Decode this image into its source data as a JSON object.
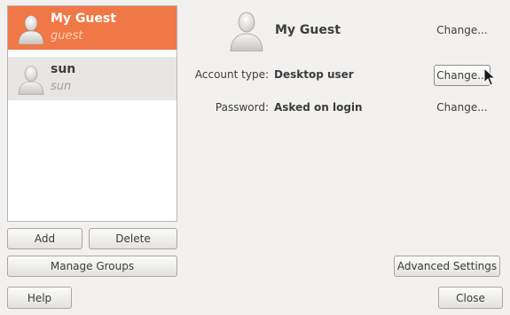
{
  "users": [
    {
      "name": "My Guest",
      "login": "guest",
      "selected": true
    },
    {
      "name": "sun",
      "login": "sun",
      "selected": false
    }
  ],
  "list_buttons": {
    "add": "Add",
    "delete": "Delete",
    "manage_groups": "Manage Groups"
  },
  "details": {
    "name": "My Guest",
    "name_change": "Change...",
    "account_type_label": "Account type:",
    "account_type_value": "Desktop user",
    "account_type_change": "Change...",
    "password_label": "Password:",
    "password_value": "Asked on login",
    "password_change": "Change..."
  },
  "footer": {
    "advanced_settings": "Advanced Settings",
    "help": "Help",
    "close": "Close"
  },
  "colors": {
    "selection": "#f07746",
    "window_bg": "#f2f1f0"
  },
  "icons": [
    "user-avatar-icon",
    "mouse-pointer-icon"
  ]
}
